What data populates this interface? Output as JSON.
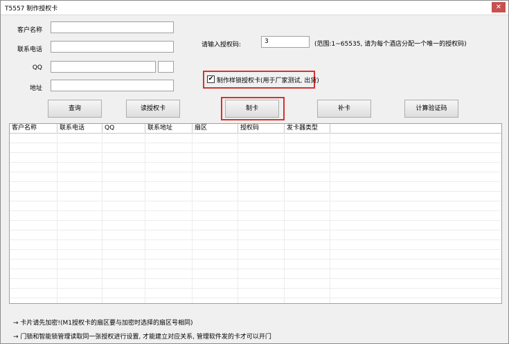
{
  "window": {
    "title": "T5557 制作授权卡",
    "close_glyph": "✕"
  },
  "form": {
    "customer_name_label": "客户名称",
    "phone_label": "联系电话",
    "qq_label": "QQ",
    "address_label": "地址",
    "customer_name_value": "",
    "phone_value": "",
    "qq_value": "",
    "qq_extra_value": "",
    "address_value": "",
    "auth_code_label": "请输入授权码:",
    "auth_code_value": "3",
    "auth_code_hint": "(范围:1~65535, 请为每个酒店分配一个唯一的授权码)",
    "sample_card_label": "制作样锁授权卡(用于厂家测试, 出货)",
    "sample_card_checked": true,
    "check_glyph": "✔"
  },
  "toolbar": {
    "query": "查询",
    "read_card": "读授权卡",
    "make_card": "制卡",
    "reissue_card": "补卡",
    "calc_code": "计算验证码"
  },
  "table": {
    "columns": [
      "客户名称",
      "联系电话",
      "QQ",
      "联系地址",
      "扇区",
      "授权码",
      "发卡器类型"
    ],
    "rows": []
  },
  "notes": {
    "line1": "→ 卡片请先加密!(M1授权卡的扇区要与加密时选择的扇区号相同)",
    "line2": "→ 门锁和智能锁管理读取同一张授权进行设置, 才能建立对应关系, 管理软件发的卡才可以开门"
  }
}
